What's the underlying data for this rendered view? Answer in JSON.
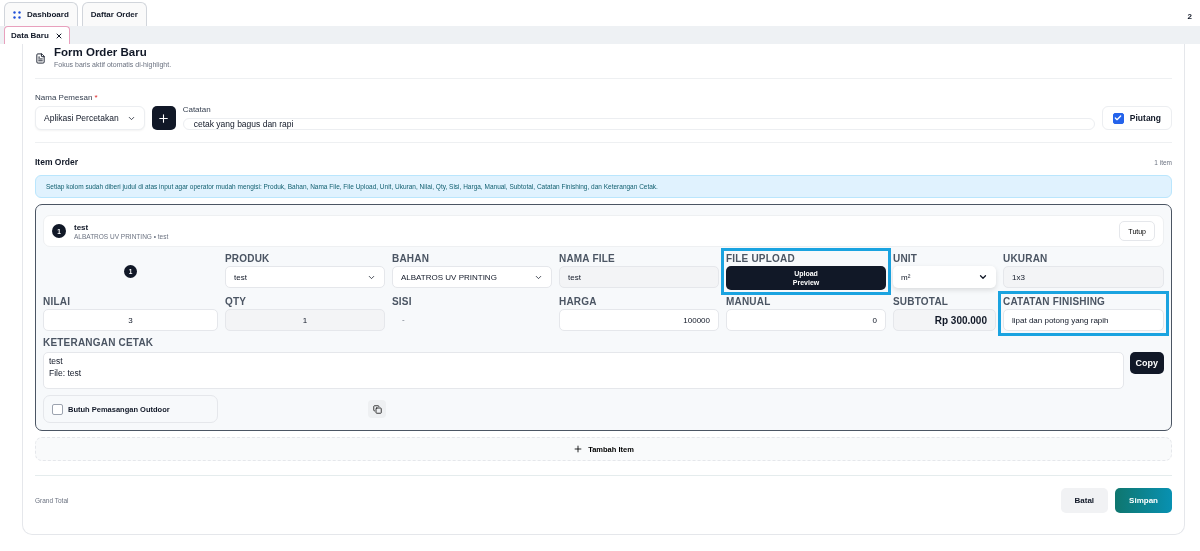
{
  "top_tabs": [
    {
      "label": "Dashboard",
      "selected": false,
      "icon": true
    },
    {
      "label": "Daftar Order",
      "selected": false,
      "icon": false
    }
  ],
  "counter": "2",
  "open_tabs": [
    {
      "label": "Data Baru",
      "selected": true,
      "closable": true
    }
  ],
  "form": {
    "title": "Form Order Baru",
    "subtitle": "Fokus baris aktif otomatis di-highlight.",
    "customer": {
      "label": "Nama Pemesan",
      "required_mark": "*",
      "value": "Aplikasi Percetakan"
    },
    "note": {
      "label": "Catatan",
      "value": "cetak yang bagus dan rapi"
    },
    "receivable": {
      "label": "Piutang",
      "checked": true
    }
  },
  "items_section": {
    "title": "Item Order",
    "count": "1 item",
    "info": "Setiap kolom sudah diberi judul di atas input agar operator mudah mengisi: Produk, Bahan, Nama File, File Upload, Unit, Ukuran, Nilai, Qty, Sisi, Harga, Manual, Subtotal, Catatan Finishing, dan Keterangan Cetak."
  },
  "item": {
    "number": "1",
    "name": "test",
    "subtitle": "ALBATROS UV PRINTING • test",
    "close_button": "Tutup",
    "badge": "1",
    "fields": [
      {
        "label": "PRODUK",
        "kind": "select",
        "value": "test",
        "highlighted": false
      },
      {
        "label": "BAHAN",
        "kind": "select",
        "value": "ALBATROS UV PRINTING",
        "highlighted": false
      },
      {
        "label": "NAMA FILE",
        "kind": "readonly",
        "value": "test",
        "highlighted": false
      },
      {
        "label": "FILE UPLOAD",
        "kind": "button",
        "value": "Upload\nPreview",
        "highlighted": true
      },
      {
        "label": "UNIT",
        "kind": "native-select",
        "value": "m²",
        "highlighted": false
      },
      {
        "label": "UKURAN",
        "kind": "readonly",
        "value": "1x3",
        "highlighted": false
      },
      {
        "label": "NILAI",
        "kind": "centered-input",
        "value": "3",
        "highlighted": false
      },
      {
        "label": "QTY",
        "kind": "centered-readonly",
        "value": "1",
        "highlighted": false
      },
      {
        "label": "SISI",
        "kind": "text",
        "value": "-",
        "highlighted": false
      },
      {
        "label": "HARGA",
        "kind": "number",
        "value": "100000",
        "highlighted": false
      },
      {
        "label": "MANUAL",
        "kind": "number",
        "value": "0",
        "highlighted": false
      },
      {
        "label": "SUBTOTAL",
        "kind": "total",
        "value": "Rp 300.000",
        "highlighted": false
      },
      {
        "label": "CATATAN FINISHING",
        "kind": "input",
        "value": "lipat dan potong yang rapih",
        "highlighted": true
      }
    ],
    "print_note": {
      "label": "KETERANGAN CETAK",
      "value": "test\nFile: test",
      "copy_button": "Copy"
    },
    "outdoor": {
      "label": "Butuh Pemasangan Outdoor",
      "checked": false
    }
  },
  "add_item": "Tambah Item",
  "footer": {
    "grand_total": "Grand Total",
    "buttons": [
      {
        "label": "Batal",
        "kind": "secondary"
      },
      {
        "label": "Simpan",
        "kind": "primary"
      }
    ]
  }
}
